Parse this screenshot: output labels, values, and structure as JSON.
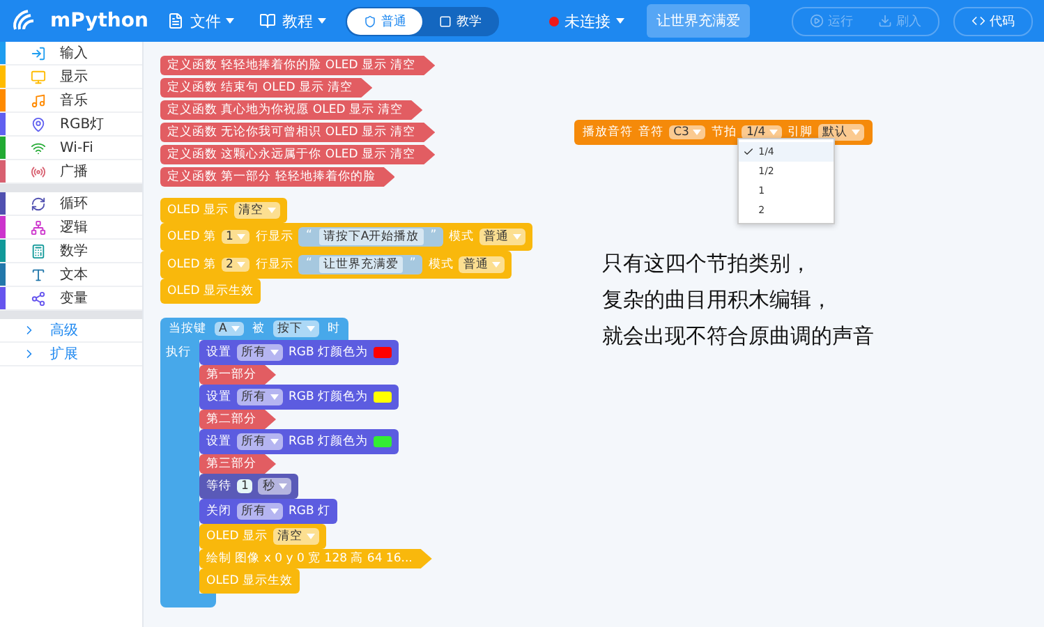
{
  "app": {
    "name": "mPython"
  },
  "menu": [
    {
      "label": "文件"
    },
    {
      "label": "教程"
    }
  ],
  "modes": [
    {
      "label": "普通",
      "selected": true
    },
    {
      "label": "教学",
      "selected": false
    }
  ],
  "connection": {
    "label": "未连接",
    "connected": false
  },
  "project_button": "让世界充满爱",
  "actions": [
    {
      "label": "运行",
      "disabled": true
    },
    {
      "label": "刷入",
      "disabled": true
    },
    {
      "label": "代码",
      "disabled": false
    }
  ],
  "sidebar": [
    {
      "label": "输入",
      "color": "#1e9df0",
      "kind": "category"
    },
    {
      "label": "显示",
      "color": "#ffbb00",
      "kind": "category"
    },
    {
      "label": "音乐",
      "color": "#ff8a00",
      "kind": "category"
    },
    {
      "label": "RGB灯",
      "color": "#6060f0",
      "kind": "category"
    },
    {
      "label": "Wi-Fi",
      "color": "#22aa33",
      "kind": "category"
    },
    {
      "label": "广播",
      "color": "#d86070",
      "kind": "category"
    },
    {
      "kind": "separator"
    },
    {
      "label": "循环",
      "color": "#5050b0",
      "kind": "category"
    },
    {
      "label": "逻辑",
      "color": "#cc33cc",
      "kind": "category"
    },
    {
      "label": "数学",
      "color": "#119999",
      "kind": "category"
    },
    {
      "label": "文本",
      "color": "#2277aa",
      "kind": "category"
    },
    {
      "label": "变量",
      "color": "#6655ee",
      "kind": "category"
    },
    {
      "kind": "separator"
    },
    {
      "label": "高级",
      "kind": "link"
    },
    {
      "label": "扩展",
      "kind": "link"
    }
  ],
  "function_blocks": [
    {
      "kind": "function",
      "parts": [
        {
          "kind": "label",
          "text": "定义函数 轻轻地捧着你的脸  OLED 显示 清空"
        }
      ]
    },
    {
      "kind": "function",
      "parts": [
        {
          "kind": "label",
          "text": "定义函数 结束句  OLED 显示 清空"
        }
      ]
    },
    {
      "kind": "function",
      "parts": [
        {
          "kind": "label",
          "text": "定义函数 真心地为你祝愿  OLED 显示 清空"
        }
      ]
    },
    {
      "kind": "function",
      "parts": [
        {
          "kind": "label",
          "text": "定义函数 无论你我可曾相识  OLED 显示 清空"
        }
      ]
    },
    {
      "kind": "function",
      "parts": [
        {
          "kind": "label",
          "text": "定义函数 这颗心永远属于你  OLED 显示 清空"
        }
      ]
    },
    {
      "kind": "function",
      "parts": [
        {
          "kind": "label",
          "text": "定义函数 第一部分  轻轻地捧着你的脸"
        }
      ]
    }
  ],
  "oled_stack": [
    {
      "kind": "oled",
      "parts": [
        {
          "kind": "label",
          "text": "OLED 显示"
        },
        {
          "kind": "dropdown",
          "text": "清空"
        }
      ]
    },
    {
      "kind": "oled",
      "parts": [
        {
          "kind": "label",
          "text": "OLED 第"
        },
        {
          "kind": "dropdown",
          "text": "1"
        },
        {
          "kind": "label",
          "text": "行显示"
        },
        {
          "kind": "string",
          "open": "“",
          "text": "请按下A开始播放",
          "close": "”"
        },
        {
          "kind": "label",
          "text": "模式"
        },
        {
          "kind": "dropdown",
          "text": "普通"
        }
      ]
    },
    {
      "kind": "oled",
      "parts": [
        {
          "kind": "label",
          "text": "OLED 第"
        },
        {
          "kind": "dropdown",
          "text": "2"
        },
        {
          "kind": "label",
          "text": "行显示"
        },
        {
          "kind": "string",
          "open": "“",
          "text": "让世界充满爱",
          "close": "”"
        },
        {
          "kind": "label",
          "text": "模式"
        },
        {
          "kind": "dropdown",
          "text": "普通"
        }
      ]
    },
    {
      "kind": "oled",
      "parts": [
        {
          "kind": "label",
          "text": "OLED 显示生效"
        }
      ]
    }
  ],
  "event_block": {
    "header": [
      {
        "kind": "label",
        "text": "当按键"
      },
      {
        "kind": "dropdown",
        "text": "A"
      },
      {
        "kind": "label",
        "text": "被"
      },
      {
        "kind": "dropdown",
        "text": "按下"
      },
      {
        "kind": "label",
        "text": "时"
      }
    ],
    "do_label": "执行",
    "statements": [
      {
        "kind": "rgb",
        "parts": [
          {
            "kind": "label",
            "text": "设置"
          },
          {
            "kind": "dropdown",
            "text": "所有"
          },
          {
            "kind": "label",
            "text": "RGB 灯颜色为"
          },
          {
            "kind": "swatch",
            "color": "#ff0000"
          }
        ]
      },
      {
        "kind": "comment",
        "parts": [
          {
            "kind": "label",
            "text": "第一部分"
          }
        ]
      },
      {
        "kind": "rgb",
        "parts": [
          {
            "kind": "label",
            "text": "设置"
          },
          {
            "kind": "dropdown",
            "text": "所有"
          },
          {
            "kind": "label",
            "text": "RGB 灯颜色为"
          },
          {
            "kind": "swatch",
            "color": "#ffff00"
          }
        ]
      },
      {
        "kind": "comment",
        "parts": [
          {
            "kind": "label",
            "text": "第二部分"
          }
        ]
      },
      {
        "kind": "rgb",
        "parts": [
          {
            "kind": "label",
            "text": "设置"
          },
          {
            "kind": "dropdown",
            "text": "所有"
          },
          {
            "kind": "label",
            "text": "RGB 灯颜色为"
          },
          {
            "kind": "swatch",
            "color": "#33ee33"
          }
        ]
      },
      {
        "kind": "comment",
        "parts": [
          {
            "kind": "label",
            "text": "第三部分"
          }
        ]
      },
      {
        "kind": "wait",
        "parts": [
          {
            "kind": "label",
            "text": "等待"
          },
          {
            "kind": "number",
            "text": "1"
          },
          {
            "kind": "dropdown",
            "text": "秒"
          }
        ]
      },
      {
        "kind": "rgb",
        "parts": [
          {
            "kind": "label",
            "text": "关闭"
          },
          {
            "kind": "dropdown",
            "text": "所有"
          },
          {
            "kind": "label",
            "text": "RGB 灯"
          }
        ]
      },
      {
        "kind": "oled",
        "parts": [
          {
            "kind": "label",
            "text": "OLED 显示"
          },
          {
            "kind": "dropdown",
            "text": "清空"
          }
        ]
      },
      {
        "kind": "draw",
        "parts": [
          {
            "kind": "label",
            "text": "绘制 图像 x 0 y 0 宽 128 高 64 16..."
          }
        ]
      },
      {
        "kind": "oled",
        "parts": [
          {
            "kind": "label",
            "text": "OLED 显示生效"
          }
        ]
      }
    ]
  },
  "note_block": {
    "kind": "music",
    "parts": [
      {
        "kind": "label",
        "text": "播放音符"
      },
      {
        "kind": "label",
        "text": "音符"
      },
      {
        "kind": "dropdown",
        "text": "C3"
      },
      {
        "kind": "label",
        "text": "节拍"
      },
      {
        "kind": "dropdown",
        "text": "1/4"
      },
      {
        "kind": "label",
        "text": "引脚"
      },
      {
        "kind": "dropdown",
        "text": "默认"
      }
    ]
  },
  "beat_menu": [
    {
      "label": "1/4",
      "selected": true
    },
    {
      "label": "1/2",
      "selected": false
    },
    {
      "label": "1",
      "selected": false
    },
    {
      "label": "2",
      "selected": false
    }
  ],
  "caption": [
    "只有这四个节拍类别，",
    "复杂的曲目用积木编辑，",
    "就会出现不符合原曲调的声音"
  ]
}
